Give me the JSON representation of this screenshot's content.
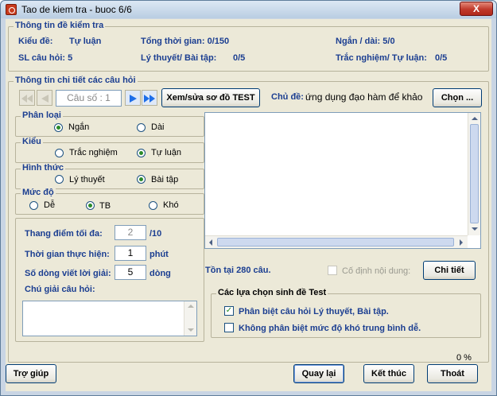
{
  "window": {
    "title": "Tao de kiem tra - buoc 6/6",
    "close": "X"
  },
  "info": {
    "title": "Thông tin đề kiểm tra",
    "kieu_de_label": "Kiểu đề:",
    "kieu_de_value": "Tự luận",
    "tong_tg": "Tổng thời gian: 0/150",
    "ngan_dai": "Ngắn / dài: 5/0",
    "sl_cau": "SL câu hỏi: 5",
    "ly_thuyet_label": "Lý thuyết/ Bài tập:",
    "ly_thuyet_value": "0/5",
    "trac_nghiem_label": "Trắc nghiệm/ Tự luận:",
    "trac_nghiem_value": "0/5"
  },
  "detail": {
    "title": "Thông tin chi tiết các câu hỏi",
    "cau_so": "Câu số : 1",
    "xem_sua": "Xem/sửa sơ đồ TEST",
    "chu_de_label": "Chủ đề:",
    "chu_de_value": "ứng dụng đạo hàm để khảo",
    "chon": "Chọn ..."
  },
  "phan_loai": {
    "title": "Phân loại",
    "opt1": "Ngắn",
    "opt2": "Dài"
  },
  "kieu": {
    "title": "Kiểu",
    "opt1": "Trắc nghiệm",
    "opt2": "Tự luận"
  },
  "hinh_thuc": {
    "title": "Hình thức",
    "opt1": "Lý thuyết",
    "opt2": "Bài tập"
  },
  "muc_do": {
    "title": "Mức độ",
    "opt1": "Dễ",
    "opt2": "TB",
    "opt3": "Khó"
  },
  "fields": {
    "thang_diem_label": "Thang điểm tối đa:",
    "thang_diem_value": "2",
    "thang_diem_unit": "/10",
    "thoi_gian_label": "Thời gian thực hiện:",
    "thoi_gian_value": "1",
    "thoi_gian_unit": "phút",
    "so_dong_label": "Số dòng viết lời giải:",
    "so_dong_value": "5",
    "so_dong_unit": "dòng",
    "chu_giai_label": "Chú giải câu hỏi:"
  },
  "ton_tai": "Tồn tại 280 câu.",
  "co_dinh": "Cố định nội dung:",
  "chi_tiet": "Chi tiết",
  "lua_chon": {
    "title": "Các lựa chọn sinh đề Test",
    "opt1": "Phân biệt câu hỏi Lý thuyết, Bài tập.",
    "opt2": "Không phân biệt mức độ khó trung bình dễ."
  },
  "progress": "0 %",
  "footer": {
    "tro_giup": "Trợ giúp",
    "quay_lai": "Quay lại",
    "ket_thuc": "Kết thúc",
    "thoat": "Thoát"
  },
  "colors": {
    "label_blue": "#1b3e91",
    "nav_blue": "#1e6ee8"
  }
}
